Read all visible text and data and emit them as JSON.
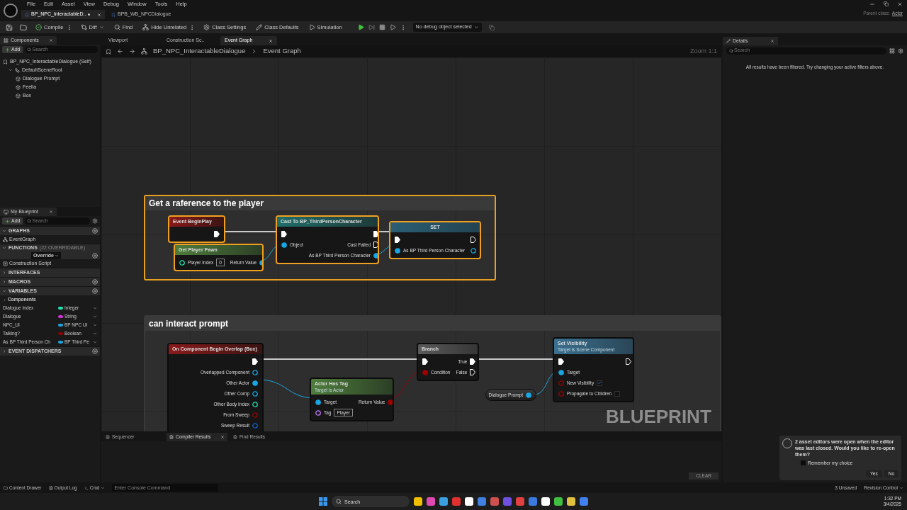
{
  "title_bar": {
    "menu": [
      "File",
      "Edit",
      "Asset",
      "View",
      "Debug",
      "Window",
      "Tools",
      "Help"
    ],
    "tabs": [
      {
        "label": "BP_NPC_InteractableD..",
        "selected": true,
        "modified": true
      },
      {
        "label": "BPB_WB_NPCDialogue",
        "selected": false,
        "modified": false
      }
    ],
    "parent_class_label": "Parent class:",
    "parent_class": "Actor"
  },
  "toolbar": {
    "buttons": [
      {
        "label": "Compile",
        "kind": "menu"
      },
      {
        "label": "Diff",
        "kind": "dropdown"
      },
      {
        "label": "Find",
        "kind": "plain"
      },
      {
        "label": "Hide Unrelated",
        "kind": "menu"
      },
      {
        "label": "Class Settings",
        "kind": "plain"
      },
      {
        "label": "Class Defaults",
        "kind": "plain"
      },
      {
        "label": "Simulation",
        "kind": "plain"
      }
    ],
    "debug_select": "No debug object selected"
  },
  "components": {
    "title": "Components",
    "add": "Add",
    "search_placeholder": "Search",
    "tree": [
      {
        "label": "BP_NPC_InteractableDialogue (Self)",
        "children": [
          {
            "label": "DefaultSceneRoot",
            "expanded": true,
            "children": [
              {
                "label": "Dialogue Prompt"
              },
              {
                "label": "Feella"
              },
              {
                "label": "Box"
              }
            ]
          }
        ]
      }
    ]
  },
  "my_blueprint": {
    "title": "My Blueprint",
    "add": "Add",
    "search_placeholder": "Search",
    "sections": [
      {
        "label": "GRAPHS",
        "expanded": true,
        "addable": true,
        "items": [
          {
            "label": "EventGraph",
            "kind": "graph"
          }
        ]
      },
      {
        "label": "FUNCTIONS",
        "note": "(22 OVERRIDABLE)",
        "override": "Override",
        "expanded": true,
        "addable": true,
        "items": [
          {
            "label": "Construction Script",
            "kind": "function"
          }
        ]
      },
      {
        "label": "INTERFACES",
        "expanded": false,
        "addable": false
      },
      {
        "label": "MACROS",
        "expanded": false,
        "addable": true
      },
      {
        "label": "VARIABLES",
        "expanded": true,
        "addable": true,
        "items": [
          {
            "label": "Components",
            "kind": "category"
          },
          {
            "label": "Dialogue Index",
            "kind": "variable",
            "type": "Integer",
            "color": "#1fe3af"
          },
          {
            "label": "Dialogue",
            "kind": "variable",
            "type": "String",
            "color": "#d42fd8"
          },
          {
            "label": "NPC_UI",
            "kind": "variable",
            "type": "BP NPC UI",
            "color": "#1aa6e0"
          },
          {
            "label": "Talking?",
            "kind": "variable",
            "type": "Boolean",
            "color": "#8c0000"
          },
          {
            "label": "As BP Third Person Ch",
            "kind": "variable",
            "type": "BP Third Pe",
            "color": "#1aa6e0"
          }
        ]
      },
      {
        "label": "EVENT DISPATCHERS",
        "expanded": false,
        "addable": true
      }
    ]
  },
  "editor_tabs": [
    {
      "label": "Viewport",
      "selected": false
    },
    {
      "label": "Construction Sc..",
      "selected": false
    },
    {
      "label": "Event Graph",
      "selected": true
    }
  ],
  "breadcrumb": [
    "BP_NPC_InteractableDialogue",
    "Event Graph"
  ],
  "zoom": "Zoom 1:1",
  "graph": {
    "comments": [
      {
        "title": "Get a raference to the player",
        "selected": true
      },
      {
        "title": "can interact prompt",
        "selected": false
      }
    ],
    "nodes": [
      {
        "kind": "event",
        "title": "Event BeginPlay",
        "selected": true,
        "right": [
          {
            "kind": "exec",
            "linked": true
          }
        ]
      },
      {
        "kind": "function",
        "title": "Get Player Pawn",
        "selected": true,
        "left": [
          {
            "label": "Player Index",
            "kind": "int",
            "linked": false,
            "value": "0"
          }
        ],
        "right": [
          {
            "label": "Return Value",
            "kind": "object",
            "linked": true
          }
        ]
      },
      {
        "kind": "cast",
        "title": "Cast To BP_ThirdPersonCharacter",
        "selected": true,
        "left": [
          {
            "kind": "exec",
            "linked": true
          },
          {
            "label": "Object",
            "kind": "object",
            "linked": true
          }
        ],
        "right": [
          {
            "kind": "exec",
            "linked": true
          },
          {
            "label": "Cast Failed",
            "kind": "exec",
            "linked": false
          },
          {
            "label": "As BP Third Person Character",
            "kind": "object",
            "linked": true
          }
        ]
      },
      {
        "kind": "set",
        "title": "SET",
        "selected": true,
        "left": [
          {
            "kind": "exec",
            "linked": true
          },
          {
            "label": "As BP Third Person Character",
            "kind": "object",
            "linked": true
          }
        ],
        "right": [
          {
            "kind": "exec",
            "linked": false
          },
          {
            "kind": "object",
            "linked": false
          }
        ]
      },
      {
        "kind": "event",
        "title": "On Component Begin Overlap (Box)",
        "selected": false,
        "right": [
          {
            "kind": "exec",
            "linked": true
          },
          {
            "label": "Overlapped Component",
            "kind": "object",
            "linked": false
          },
          {
            "label": "Other Actor",
            "kind": "object",
            "linked": true
          },
          {
            "label": "Other Comp",
            "kind": "object",
            "linked": false
          },
          {
            "label": "Other Body Index",
            "kind": "int",
            "linked": false
          },
          {
            "label": "From Sweep",
            "kind": "bool",
            "linked": false
          },
          {
            "label": "Sweep Result",
            "kind": "struct",
            "linked": false
          }
        ]
      },
      {
        "kind": "function",
        "title": "Actor Has Tag",
        "subtitle": "Target is Actor",
        "selected": false,
        "left": [
          {
            "label": "Target",
            "kind": "object",
            "linked": true
          },
          {
            "label": "Tag",
            "kind": "name",
            "linked": false,
            "value": "Player"
          }
        ],
        "right": [
          {
            "label": "Return Value",
            "kind": "bool",
            "linked": true
          }
        ]
      },
      {
        "kind": "branch",
        "title": "Branch",
        "selected": false,
        "left": [
          {
            "kind": "exec",
            "linked": true
          },
          {
            "label": "Condition",
            "kind": "bool",
            "linked": true
          }
        ],
        "right": [
          {
            "label": "True",
            "kind": "exec",
            "linked": true
          },
          {
            "label": "False",
            "kind": "exec",
            "linked": false
          }
        ]
      },
      {
        "kind": "variable",
        "title": "Dialogue Prompt",
        "selected": false,
        "right": [
          {
            "kind": "object",
            "linked": true
          }
        ]
      },
      {
        "kind": "target_function",
        "title": "Set Visibility",
        "subtitle": "Target is Scene Component",
        "selected": false,
        "left": [
          {
            "kind": "exec",
            "linked": true
          },
          {
            "label": "Target",
            "kind": "object",
            "linked": true
          },
          {
            "label": "New Visibility",
            "kind": "bool",
            "linked": false,
            "checked": true
          },
          {
            "label": "Propagate to Children",
            "kind": "bool",
            "linked": false,
            "checked": false
          }
        ],
        "right": [
          {
            "kind": "exec",
            "linked": false
          }
        ]
      }
    ],
    "watermark": "BLUEPRINT"
  },
  "bottom_panel": {
    "tabs": [
      {
        "label": "Sequencer",
        "selected": false
      },
      {
        "label": "Compiler Results",
        "selected": true
      },
      {
        "label": "Find Results",
        "selected": false
      }
    ],
    "clear": "CLEAR"
  },
  "details": {
    "title": "Details",
    "search_placeholder": "Search",
    "message": "All results have been filtered. Try changing your active filters above."
  },
  "status_bar": {
    "left": [
      "Content Drawer",
      "Output Log"
    ],
    "cmd": "Cmd",
    "console_placeholder": "Enter Console Command",
    "unsaved": "3 Unsaved",
    "revision": "Revision Control"
  },
  "notification": {
    "message": "2 asset editors were open when the editor was last closed. Would you like to re-open them?",
    "remember": "Remember my choice",
    "checked": false,
    "buttons": [
      "Yes",
      "No"
    ]
  },
  "taskbar": {
    "search_placeholder": "Search",
    "time": "1:32 PM",
    "date": "3/4/2025"
  }
}
